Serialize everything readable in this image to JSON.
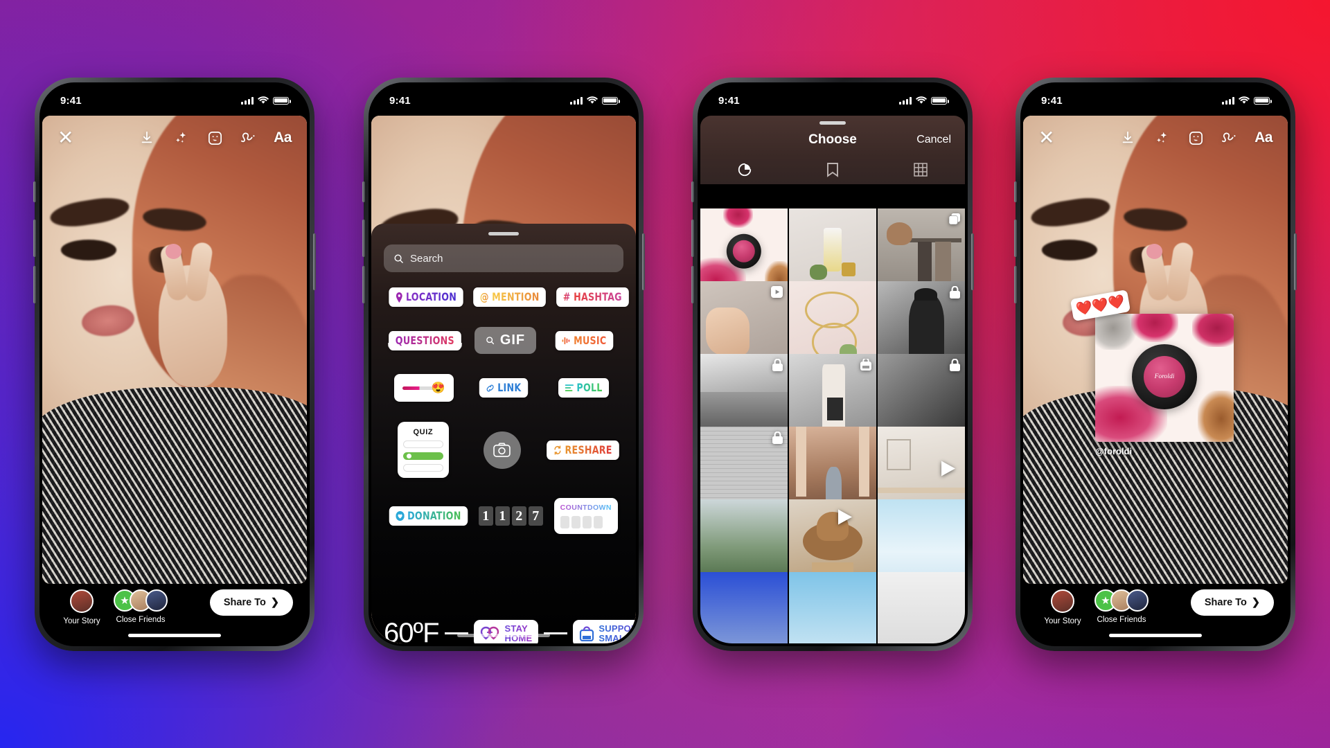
{
  "background": {
    "colors": [
      "#8e2299",
      "#f5162f",
      "#2626f0",
      "#9127a8"
    ]
  },
  "status_bar": {
    "time": "9:41",
    "signal_icon": "cellular-bars-icon",
    "wifi_icon": "wifi-icon",
    "battery_icon": "battery-icon"
  },
  "phone1": {
    "top_toolbar": {
      "close_label": "✕",
      "icons": [
        "download-icon",
        "sparkle-icon",
        "sticker-icon",
        "draw-icon"
      ],
      "text_tool_label": "Aa"
    },
    "share_bar": {
      "your_story_label": "Your Story",
      "close_friends_label": "Close Friends",
      "share_button_label": "Share To",
      "chevron": "❯"
    }
  },
  "phone2": {
    "search": {
      "placeholder": "Search",
      "icon": "search-icon"
    },
    "stickers": [
      {
        "name": "location",
        "label": "LOCATION",
        "icon": "pin-icon",
        "style": "gr-loc"
      },
      {
        "name": "mention",
        "label": "MENTION",
        "icon": "at-icon",
        "style": "gr-men"
      },
      {
        "name": "hashtag",
        "label": "HASHTAG",
        "icon": "hash-icon",
        "style": "gr-hash"
      },
      {
        "name": "questions",
        "label": "QUESTIONS",
        "style": "gr-ques"
      },
      {
        "name": "gif",
        "label": "GIF",
        "icon": "search-icon"
      },
      {
        "name": "music",
        "label": "MUSIC",
        "icon": "equalizer-icon",
        "style": "gr-music"
      },
      {
        "name": "slider",
        "label": "",
        "emoji": "😍"
      },
      {
        "name": "link",
        "label": "LINK",
        "icon": "link-icon",
        "style": "gr-link"
      },
      {
        "name": "poll",
        "label": "POLL",
        "icon": "poll-icon",
        "style": "gr-poll"
      },
      {
        "name": "quiz",
        "label": "QUIZ"
      },
      {
        "name": "camera",
        "label": "",
        "icon": "camera-icon"
      },
      {
        "name": "reshare",
        "label": "RESHARE",
        "icon": "reshare-icon",
        "style": "gr-resh"
      },
      {
        "name": "donation",
        "label": "DONATION",
        "icon": "heart-circle-icon",
        "style": "gr-don"
      },
      {
        "name": "countdown",
        "label": "COUNTDOWN",
        "style": "gr-cd"
      }
    ],
    "countdown_digits": [
      "1",
      "1",
      "2",
      "7"
    ],
    "temperature": "60ºF",
    "stay_home": {
      "line1": "STAY",
      "line2": "HOME",
      "icon": "heart-home-icon"
    },
    "support_small": {
      "line1": "SUPPORT",
      "line2": "SMALL",
      "icon": "shopping-bag-icon"
    }
  },
  "phone3": {
    "title": "Choose",
    "cancel_label": "Cancel",
    "tabs": [
      {
        "name": "recents",
        "icon": "recents-icon",
        "active": true
      },
      {
        "name": "saved",
        "icon": "bookmark-icon",
        "active": false
      },
      {
        "name": "grid",
        "icon": "grid-icon",
        "active": false
      }
    ],
    "grid": [
      {
        "art": "a-makeup",
        "badge": "",
        "selected": true
      },
      {
        "art": "a-oil",
        "badge": ""
      },
      {
        "art": "a-rack",
        "badge": "carousel-icon"
      },
      {
        "art": "a-nails",
        "badge": "reels-icon"
      },
      {
        "art": "a-jewel",
        "badge": ""
      },
      {
        "art": "a-bw1",
        "badge": "lock-icon"
      },
      {
        "art": "a-bw2",
        "badge": "lock-icon"
      },
      {
        "art": "a-bw3",
        "badge": "bag-icon"
      },
      {
        "art": "a-bw4",
        "badge": "lock-icon"
      },
      {
        "art": "a-brick",
        "badge": "lock-icon"
      },
      {
        "art": "a-arch",
        "badge": ""
      },
      {
        "art": "a-room",
        "badge": "play-icon"
      },
      {
        "art": "a-forest",
        "badge": ""
      },
      {
        "art": "a-hat",
        "badge": "play-icon"
      },
      {
        "art": "a-snow",
        "badge": ""
      },
      {
        "art": "a-blue",
        "badge": ""
      },
      {
        "art": "a-sea",
        "badge": ""
      },
      {
        "art": "a-white",
        "badge": ""
      }
    ]
  },
  "phone4": {
    "top_toolbar": {
      "close_label": "✕",
      "icons": [
        "download-icon",
        "sparkle-icon",
        "sticker-icon",
        "draw-icon"
      ],
      "text_tool_label": "Aa"
    },
    "product_sticker": {
      "handle": "@foroldi",
      "brand_text": "Foroldi"
    },
    "hearts_sticker": {
      "emojis": "❤️❤️❤️"
    },
    "share_bar": {
      "your_story_label": "Your Story",
      "close_friends_label": "Close Friends",
      "share_button_label": "Share To",
      "chevron": "❯"
    }
  }
}
